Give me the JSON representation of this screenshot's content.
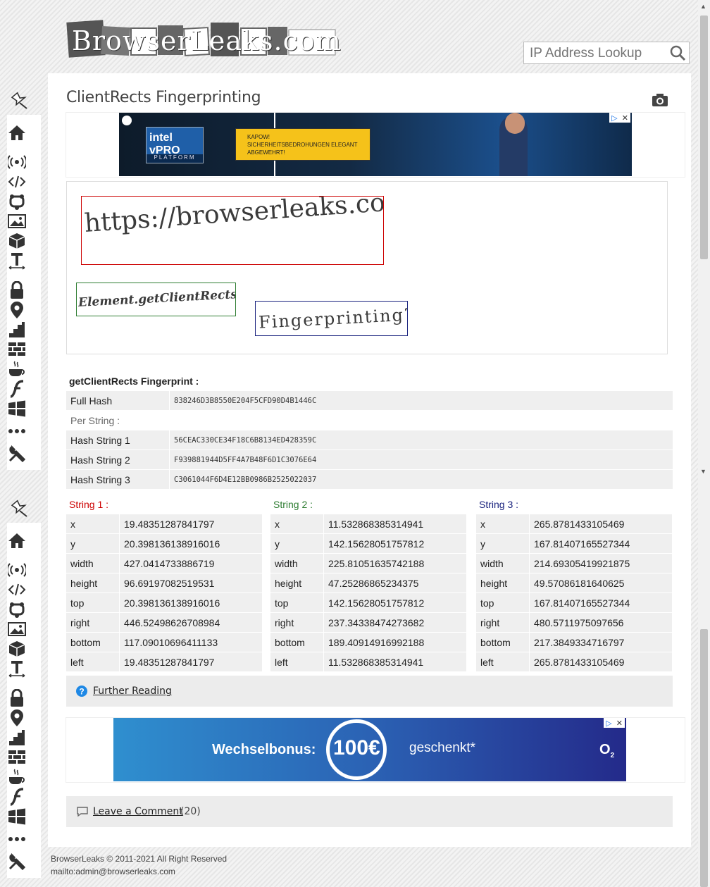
{
  "header": {
    "logo_text": "BrowserLeaks.com",
    "search_placeholder": "IP Address Lookup"
  },
  "sidebar_icons": [
    "pin-icon",
    "home-icon",
    "broadcast-icon",
    "code-icon",
    "webgl-icon",
    "image-icon",
    "cube-icon",
    "font-icon",
    "lock-icon",
    "location-icon",
    "stairs-icon",
    "firewall-icon",
    "java-icon",
    "flash-icon",
    "windows-icon",
    "more-icon",
    "tools-icon"
  ],
  "page": {
    "title": "ClientRects Fingerprinting"
  },
  "ad_top": {
    "brand": "intel vPRO",
    "brand_sub": "PLATFORM",
    "tagline_1": "KAPOW!",
    "tagline_2": "SICHERHEITSBEDROHUNGEN ELEGANT",
    "tagline_3": "ABGEWEHRT!"
  },
  "rects_demo": {
    "text_1": "https://browserleaks.com/rects",
    "text_2": "Element.getClientRects",
    "text_3": "Fingerprinting?",
    "colors": [
      "#cc0000",
      "#2e7d32",
      "#1a237e"
    ]
  },
  "fingerprint": {
    "heading": "getClientRects Fingerprint :",
    "full_hash_label": "Full Hash",
    "full_hash": "838246D3B8550E204F5CFD90D4B1446C",
    "per_string_label": "Per String :",
    "hashes": [
      {
        "label": "Hash String 1",
        "value": "56CEAC330CE34F18C6B8134ED428359C"
      },
      {
        "label": "Hash String 2",
        "value": "F939881944D5FF4A7B48F6D1C3076E64"
      },
      {
        "label": "Hash String 3",
        "value": "C3061044F6D4E12BB0986B2525022037"
      }
    ]
  },
  "strings": [
    {
      "title": "String 1 :",
      "color": "#cc0000",
      "rows": [
        {
          "k": "x",
          "v": "19.48351287841797"
        },
        {
          "k": "y",
          "v": "20.398136138916016"
        },
        {
          "k": "width",
          "v": "427.0414733886719"
        },
        {
          "k": "height",
          "v": "96.69197082519531"
        },
        {
          "k": "top",
          "v": "20.398136138916016"
        },
        {
          "k": "right",
          "v": "446.52498626708984"
        },
        {
          "k": "bottom",
          "v": "117.09010696411133"
        },
        {
          "k": "left",
          "v": "19.48351287841797"
        }
      ]
    },
    {
      "title": "String 2 :",
      "color": "#2e7d32",
      "rows": [
        {
          "k": "x",
          "v": "11.532868385314941"
        },
        {
          "k": "y",
          "v": "142.15628051757812"
        },
        {
          "k": "width",
          "v": "225.81051635742188"
        },
        {
          "k": "height",
          "v": "47.25286865234375"
        },
        {
          "k": "top",
          "v": "142.15628051757812"
        },
        {
          "k": "right",
          "v": "237.34338474273682"
        },
        {
          "k": "bottom",
          "v": "189.40914916992188"
        },
        {
          "k": "left",
          "v": "11.532868385314941"
        }
      ]
    },
    {
      "title": "String 3 :",
      "color": "#1a237e",
      "rows": [
        {
          "k": "x",
          "v": "265.8781433105469"
        },
        {
          "k": "y",
          "v": "167.81407165527344"
        },
        {
          "k": "width",
          "v": "214.69305419921875"
        },
        {
          "k": "height",
          "v": "49.57086181640625"
        },
        {
          "k": "top",
          "v": "167.81407165527344"
        },
        {
          "k": "right",
          "v": "480.5711975097656"
        },
        {
          "k": "bottom",
          "v": "217.3849334716797"
        },
        {
          "k": "left",
          "v": "265.8781433105469"
        }
      ]
    }
  ],
  "further_reading": "Further Reading",
  "ad_bottom": {
    "text_1": "Wechselbonus:",
    "amount": "100€",
    "text_2": "geschenkt*",
    "brand": "O",
    "brand_sub": "2"
  },
  "comments": {
    "label": "Leave a Comment",
    "count": "(20)"
  },
  "footer": {
    "copyright": "BrowserLeaks © 2011-2021 All Right Reserved",
    "contact": "mailto:admin@browserleaks.com"
  }
}
